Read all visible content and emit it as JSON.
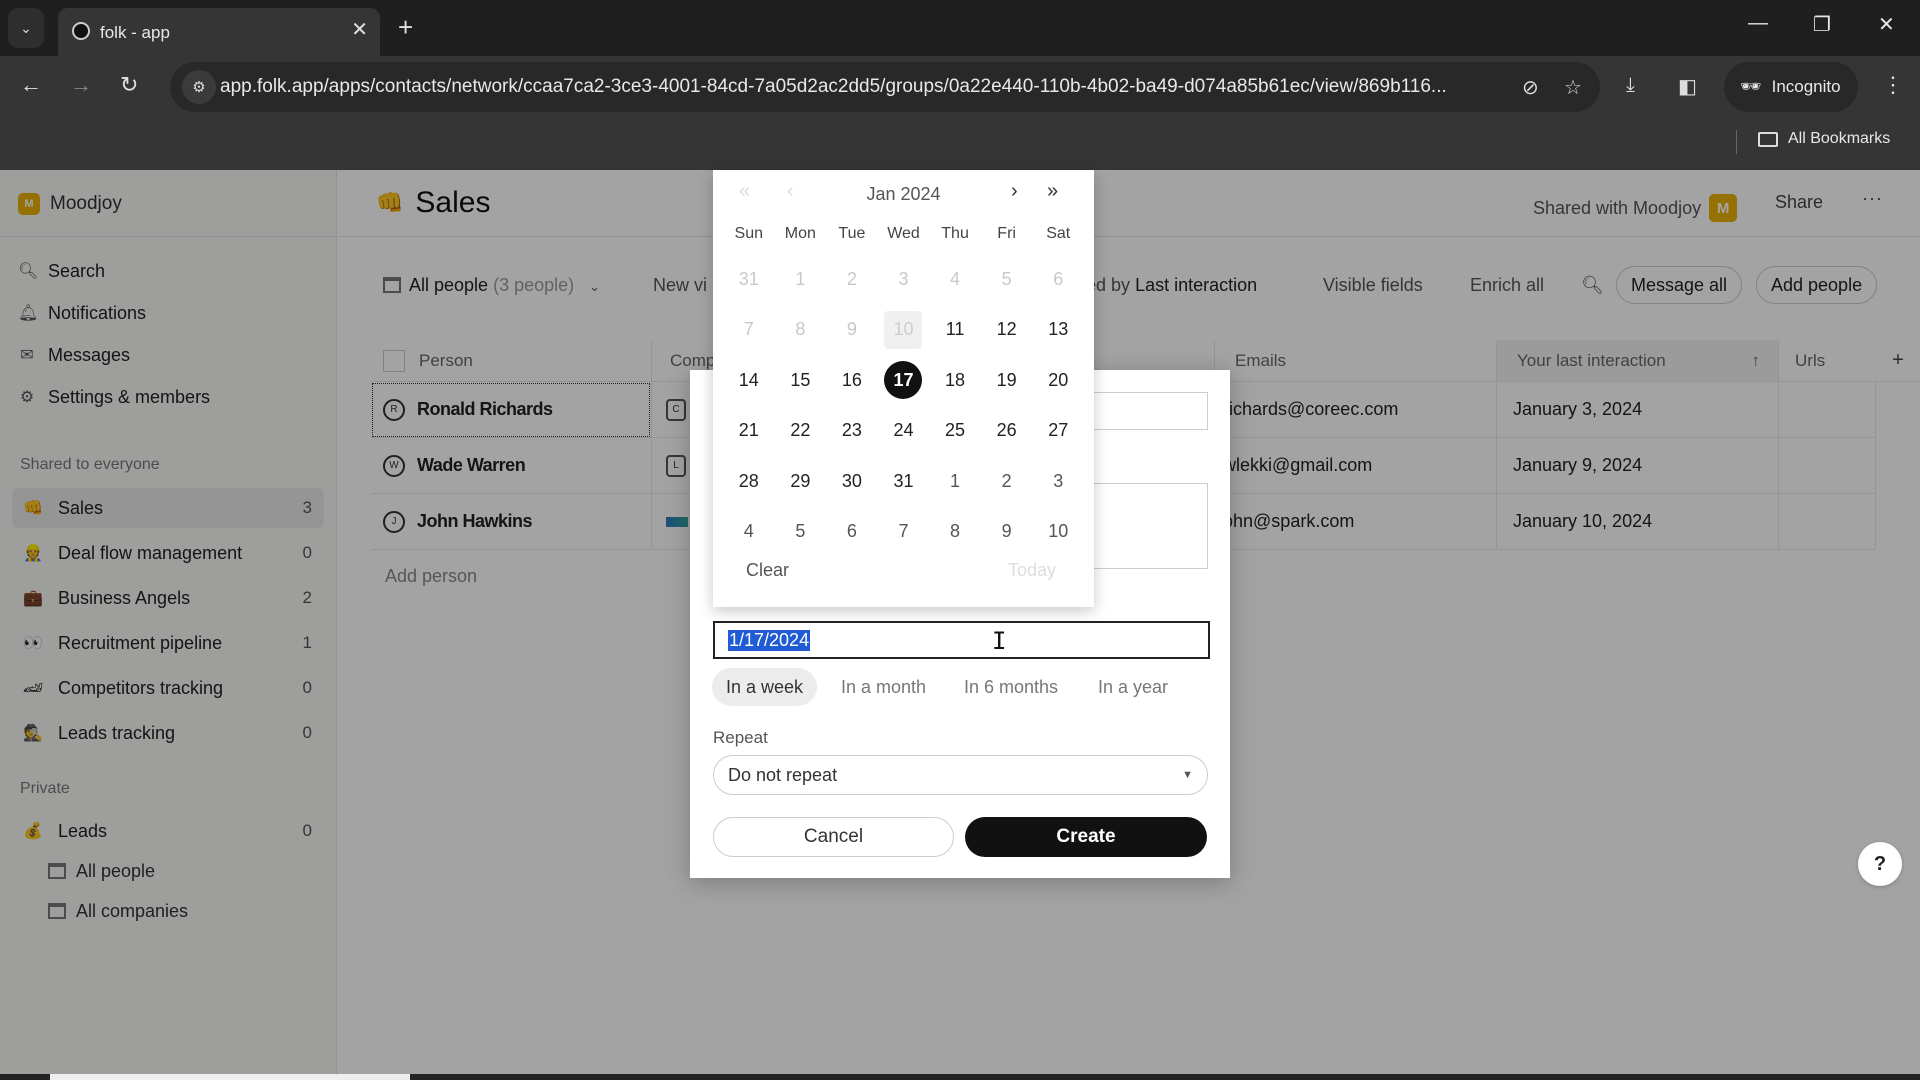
{
  "browser": {
    "tab_title": "folk - app",
    "url": "app.folk.app/apps/contacts/network/ccaa7ca2-3ce3-4001-84cd-7a05d2ac2dd5/groups/0a22e440-110b-4b02-ba49-d074a85b61ec/view/869b116...",
    "incognito_label": "Incognito",
    "bookmarks_label": "All Bookmarks"
  },
  "sidebar": {
    "workspace": {
      "initial": "M",
      "name": "Moodjoy"
    },
    "nav": [
      {
        "label": "Search",
        "icon": "search-icon"
      },
      {
        "label": "Notifications",
        "icon": "bell-icon"
      },
      {
        "label": "Messages",
        "icon": "mail-icon"
      },
      {
        "label": "Settings & members",
        "icon": "gear-icon"
      }
    ],
    "shared_section": "Shared to everyone",
    "groups": [
      {
        "emoji": "👊",
        "label": "Sales",
        "count": "3",
        "active": true
      },
      {
        "emoji": "👷",
        "label": "Deal flow management",
        "count": "0"
      },
      {
        "emoji": "💼",
        "label": "Business Angels",
        "count": "2"
      },
      {
        "emoji": "👀",
        "label": "Recruitment pipeline",
        "count": "1"
      },
      {
        "emoji": "🏎",
        "label": "Competitors tracking",
        "count": "0"
      },
      {
        "emoji": "🕵",
        "label": "Leads tracking",
        "count": "0"
      }
    ],
    "private_section": "Private",
    "private_groups": [
      {
        "emoji": "💰",
        "label": "Leads",
        "count": "0"
      }
    ],
    "views": [
      {
        "label": "All people"
      },
      {
        "label": "All companies"
      }
    ]
  },
  "main": {
    "title": "Sales",
    "title_emoji": "👊",
    "shared_with": "Shared with Moodjoy",
    "shared_badge": "M",
    "share_label": "Share",
    "more_label": "···",
    "toolbar": {
      "view_label": "All people",
      "view_count": "(3 people)",
      "new_view": "New vi",
      "sorted_prefix": "ed by",
      "sorted_field": "Last interaction",
      "visible_fields": "Visible fields",
      "enrich_all": "Enrich all",
      "message_all": "Message all",
      "add_people": "Add people"
    },
    "columns": {
      "person": "Person",
      "company": "Comp",
      "emails": "Emails",
      "last_interaction": "Your last interaction",
      "urls": "Urls",
      "add": "+"
    },
    "rows": [
      {
        "initial": "R",
        "name": "Ronald Richards",
        "company_initial": "C",
        "email": "richards@coreec.com",
        "last": "January 3, 2024"
      },
      {
        "initial": "W",
        "name": "Wade Warren",
        "company_initial": "L",
        "email": "wlekki@gmail.com",
        "last": "January 9, 2024"
      },
      {
        "initial": "J",
        "name": "John Hawkins",
        "company_initial": "",
        "email": "ohn@spark.com",
        "last": "January 10, 2024"
      }
    ],
    "add_person": "Add person",
    "help": "?"
  },
  "calendar": {
    "month_label": "Jan 2024",
    "weekdays": [
      "Sun",
      "Mon",
      "Tue",
      "Wed",
      "Thu",
      "Fri",
      "Sat"
    ],
    "days": [
      [
        "31",
        "muted"
      ],
      [
        "1",
        "muted"
      ],
      [
        "2",
        "muted"
      ],
      [
        "3",
        "muted"
      ],
      [
        "4",
        "muted"
      ],
      [
        "5",
        "muted"
      ],
      [
        "6",
        "muted"
      ],
      [
        "7",
        "muted"
      ],
      [
        "8",
        "muted"
      ],
      [
        "9",
        "muted"
      ],
      [
        "10",
        "today-disabled"
      ],
      [
        "11",
        ""
      ],
      [
        "12",
        ""
      ],
      [
        "13",
        ""
      ],
      [
        "14",
        ""
      ],
      [
        "15",
        ""
      ],
      [
        "16",
        ""
      ],
      [
        "17",
        "selected"
      ],
      [
        "18",
        ""
      ],
      [
        "19",
        ""
      ],
      [
        "20",
        ""
      ],
      [
        "21",
        ""
      ],
      [
        "22",
        ""
      ],
      [
        "23",
        ""
      ],
      [
        "24",
        ""
      ],
      [
        "25",
        ""
      ],
      [
        "26",
        ""
      ],
      [
        "27",
        ""
      ],
      [
        "28",
        ""
      ],
      [
        "29",
        ""
      ],
      [
        "30",
        ""
      ],
      [
        "31",
        ""
      ],
      [
        "1",
        "next"
      ],
      [
        "2",
        "next"
      ],
      [
        "3",
        "next"
      ],
      [
        "4",
        "next"
      ],
      [
        "5",
        "next"
      ],
      [
        "6",
        "next"
      ],
      [
        "7",
        "next"
      ],
      [
        "8",
        "next"
      ],
      [
        "9",
        "next"
      ],
      [
        "10",
        "next"
      ]
    ],
    "clear_label": "Clear",
    "today_label": "Today"
  },
  "reminder_modal": {
    "date_value": "1/17/2024",
    "quick_options": [
      {
        "label": "In a week",
        "active": true
      },
      {
        "label": "In a month"
      },
      {
        "label": "In 6 months"
      },
      {
        "label": "In a year"
      }
    ],
    "repeat_label": "Repeat",
    "repeat_value": "Do not repeat",
    "cancel_label": "Cancel",
    "create_label": "Create"
  }
}
